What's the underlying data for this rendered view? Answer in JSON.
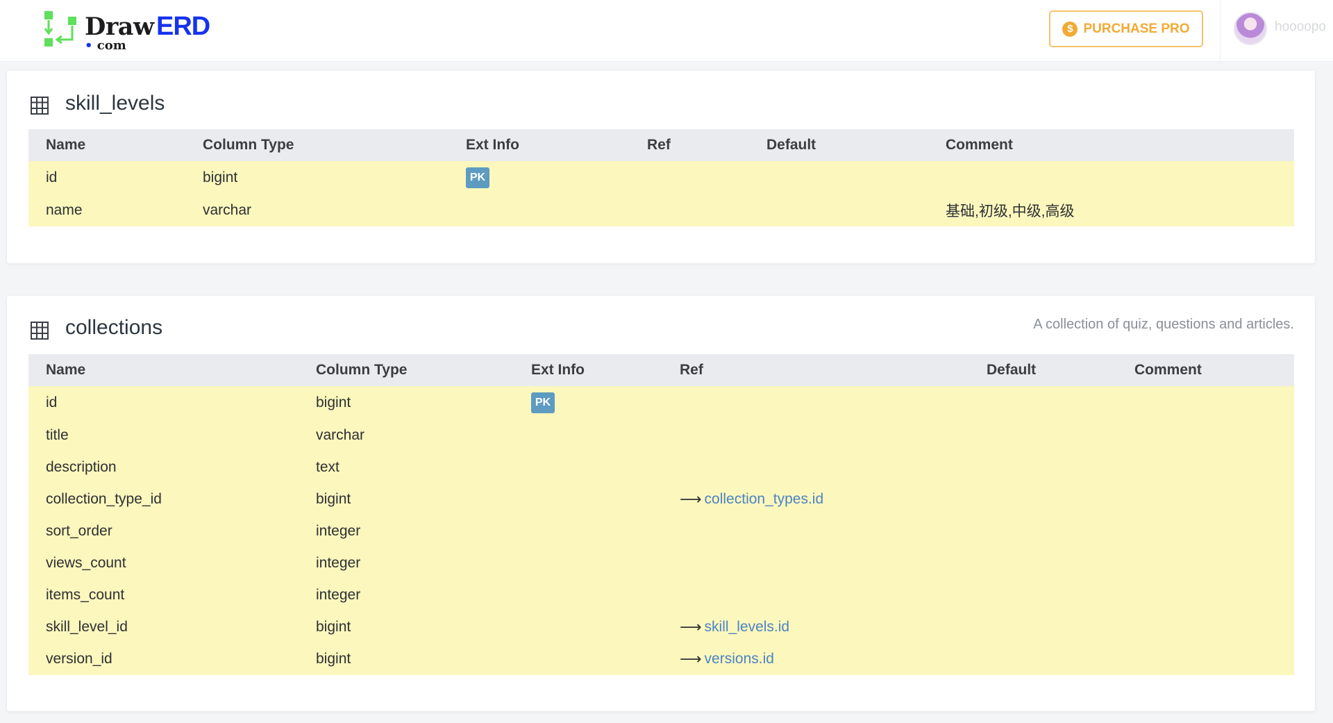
{
  "header": {
    "logo_draw": "Draw",
    "logo_erd": "ERD",
    "logo_dot": "•",
    "logo_com": "com",
    "purchase_label": "PURCHASE PRO",
    "coin_symbol": "$",
    "username": "hoooopo"
  },
  "colors": {
    "accent": "#f2aa35",
    "brand_blue": "#1632f0",
    "row_highlight": "#fbf7bd",
    "pk_badge": "#5d9bc1",
    "link": "#4c84c4"
  },
  "tables": [
    {
      "name": "skill_levels",
      "description": "",
      "headers": [
        "Name",
        "Column Type",
        "Ext Info",
        "Ref",
        "Default",
        "Comment"
      ],
      "rows": [
        {
          "name": "id",
          "type": "bigint",
          "ext": "PK",
          "ref": "",
          "default": "",
          "comment": ""
        },
        {
          "name": "name",
          "type": "varchar",
          "ext": "",
          "ref": "",
          "default": "",
          "comment": "基础,初级,中级,高级"
        }
      ]
    },
    {
      "name": "collections",
      "description": "A collection of quiz, questions and articles.",
      "headers": [
        "Name",
        "Column Type",
        "Ext Info",
        "Ref",
        "Default",
        "Comment"
      ],
      "rows": [
        {
          "name": "id",
          "type": "bigint",
          "ext": "PK",
          "ref": "",
          "default": "",
          "comment": ""
        },
        {
          "name": "title",
          "type": "varchar",
          "ext": "",
          "ref": "",
          "default": "",
          "comment": ""
        },
        {
          "name": "description",
          "type": "text",
          "ext": "",
          "ref": "",
          "default": "",
          "comment": ""
        },
        {
          "name": "collection_type_id",
          "type": "bigint",
          "ext": "",
          "ref": "collection_types.id",
          "default": "",
          "comment": ""
        },
        {
          "name": "sort_order",
          "type": "integer",
          "ext": "",
          "ref": "",
          "default": "",
          "comment": ""
        },
        {
          "name": "views_count",
          "type": "integer",
          "ext": "",
          "ref": "",
          "default": "",
          "comment": ""
        },
        {
          "name": "items_count",
          "type": "integer",
          "ext": "",
          "ref": "",
          "default": "",
          "comment": ""
        },
        {
          "name": "skill_level_id",
          "type": "bigint",
          "ext": "",
          "ref": "skill_levels.id",
          "default": "",
          "comment": ""
        },
        {
          "name": "version_id",
          "type": "bigint",
          "ext": "",
          "ref": "versions.id",
          "default": "",
          "comment": ""
        }
      ]
    }
  ],
  "ref_arrow": "⟶"
}
